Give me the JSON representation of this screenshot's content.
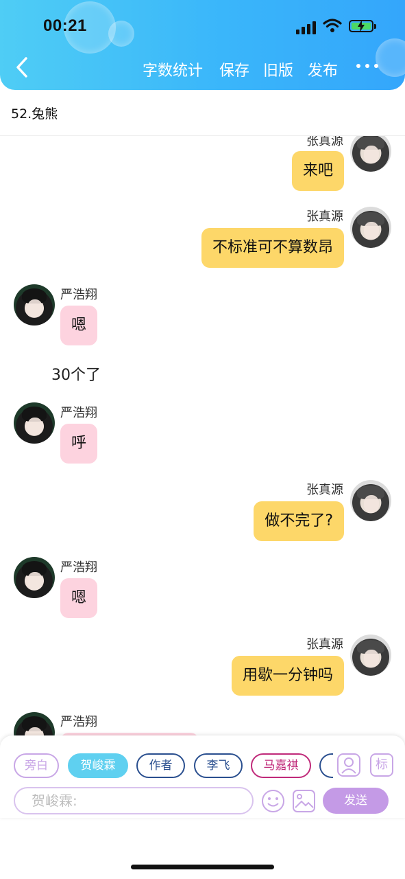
{
  "status_bar": {
    "time": "00:21"
  },
  "header": {
    "toolbar": [
      "字数统计",
      "保存",
      "旧版",
      "发布"
    ]
  },
  "document": {
    "title": "52.兔熊"
  },
  "messages": [
    {
      "side": "right",
      "speaker": "张真源",
      "text": "来吧"
    },
    {
      "side": "right",
      "speaker": "张真源",
      "text": "不标准可不算数昂"
    },
    {
      "side": "left",
      "speaker": "严浩翔",
      "text": "嗯"
    },
    {
      "side": "narration",
      "text": "30个了"
    },
    {
      "side": "left",
      "speaker": "严浩翔",
      "text": "呼"
    },
    {
      "side": "right",
      "speaker": "张真源",
      "text": "做不完了?"
    },
    {
      "side": "left",
      "speaker": "严浩翔",
      "text": "嗯"
    },
    {
      "side": "right",
      "speaker": "张真源",
      "text": "用歇一分钟吗"
    },
    {
      "side": "left",
      "speaker": "严浩翔",
      "text": ""
    }
  ],
  "character_chips": [
    {
      "label": "旁白",
      "color": "#c8a6e6",
      "active": false
    },
    {
      "label": "贺峻霖",
      "color": "#5fd0f0",
      "active": true
    },
    {
      "label": "作者",
      "color": "#2a4f8f",
      "active": false
    },
    {
      "label": "李飞",
      "color": "#2a4f8f",
      "active": false
    },
    {
      "label": "马嘉祺",
      "color": "#c02a7a",
      "active": false
    }
  ],
  "input": {
    "placeholder": "贺峻霖:",
    "send_label": "发送",
    "mark_label": "标"
  },
  "colors": {
    "accent": "#3ab6fa",
    "right_bubble": "#fdd769",
    "left_bubble": "#fdd3df",
    "send": "#c49ae6"
  }
}
